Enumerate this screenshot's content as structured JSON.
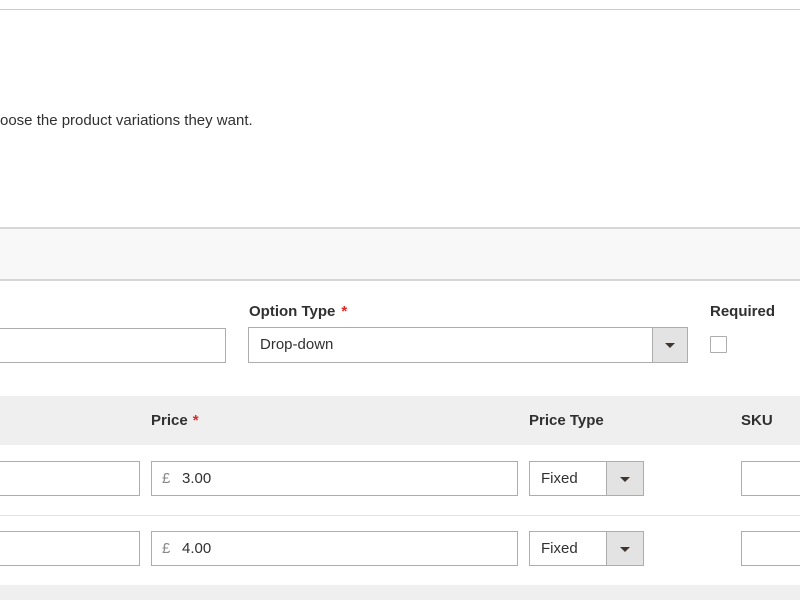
{
  "intro": {
    "description": "oose the product variations they want."
  },
  "option": {
    "title_value": "",
    "type_label": "Option Type",
    "required_mark": "*",
    "type_value": "Drop-down",
    "required_label": "Required",
    "required_checked": false
  },
  "grid": {
    "headers": {
      "price": "Price",
      "price_required_mark": "*",
      "price_type": "Price Type",
      "sku": "SKU"
    },
    "rows": [
      {
        "title": "",
        "currency": "£",
        "price": "3.00",
        "price_type": "Fixed",
        "sku": ""
      },
      {
        "title": "",
        "currency": "£",
        "price": "4.00",
        "price_type": "Fixed",
        "sku": ""
      }
    ]
  },
  "icons": {
    "dropdown": "chevron-down-icon"
  }
}
